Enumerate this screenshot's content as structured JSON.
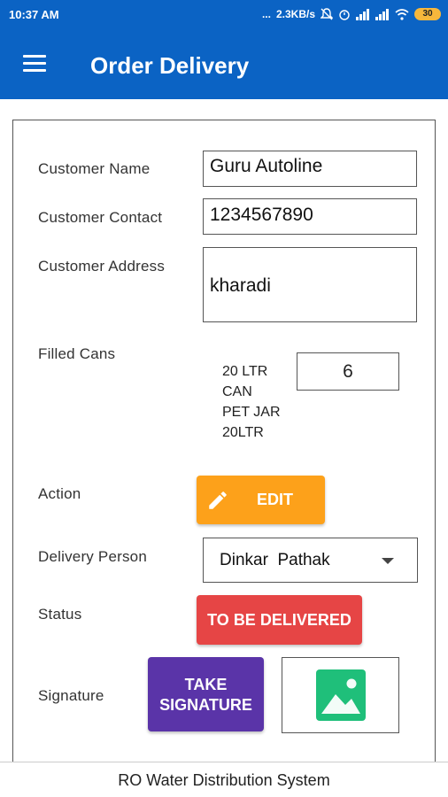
{
  "status_bar": {
    "time": "10:37 AM",
    "dots": "...",
    "speed": "2.3KB/s",
    "battery": "30"
  },
  "app_bar": {
    "title": "Order Delivery"
  },
  "form": {
    "customer_name": {
      "label": "Customer Name",
      "value": "Guru Autoline"
    },
    "customer_contact": {
      "label": "Customer Contact",
      "value": "1234567890"
    },
    "customer_address": {
      "label": "Customer Address",
      "value": "kharadi"
    },
    "filled_cans": {
      "label": "Filled Cans",
      "product_line1": "20 LTR",
      "product_line2": "CAN",
      "product_line3": "PET JAR",
      "product_line4": "20LTR",
      "quantity": "6"
    },
    "action": {
      "label": "Action",
      "button": "EDIT"
    },
    "delivery_person": {
      "label": "Delivery Person",
      "selected": "Dinkar  Pathak"
    },
    "status": {
      "label": "Status",
      "button": "TO BE DELIVERED"
    },
    "signature": {
      "label": "Signature",
      "button_line1": "TAKE",
      "button_line2": "SIGNATURE"
    }
  },
  "footer": {
    "text": "RO Water Distribution System"
  },
  "colors": {
    "primary": "#0b63c4",
    "edit": "#fda11a",
    "status": "#e64545",
    "signature": "#5a34a8",
    "gallery": "#1fbf7a"
  },
  "icons": [
    "menu-icon",
    "pencil-icon",
    "dropdown-caret-icon",
    "image-gallery-icon",
    "wifi-icon",
    "signal-icon",
    "alarm-icon",
    "mute-icon"
  ]
}
